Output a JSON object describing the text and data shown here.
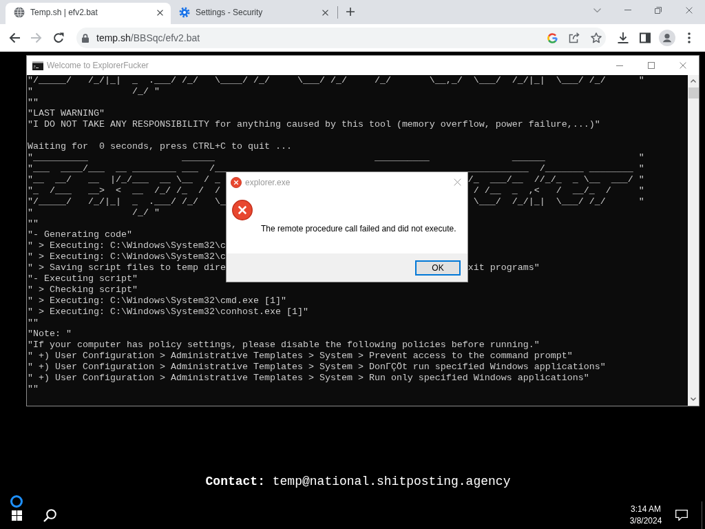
{
  "browser": {
    "tabs": [
      {
        "title": "Temp.sh | efv2.bat",
        "selected": true
      },
      {
        "title": "Settings - Security",
        "selected": false
      }
    ],
    "nav": [
      {
        "kind": "back",
        "disabled": false
      },
      {
        "kind": "forward",
        "disabled": true
      },
      {
        "kind": "reload",
        "disabled": false
      }
    ],
    "address": {
      "host": "temp.sh",
      "path": "/BBSqc/efv2.bat"
    }
  },
  "console_window": {
    "title": "Welcome to ExplorerFucker",
    "lines": [
      {
        "kind": "text",
        "text": "\"/_____/   /_/|_|  _  .___/ /_/   \\____/ /_/     \\___/ /_/     /_/       \\__,_/  \\___/  /_/|_|  \\___/ /_/      \""
      },
      {
        "kind": "text",
        "text": "\"                  /_/ \""
      },
      {
        "kind": "text",
        "text": "\"\""
      },
      {
        "kind": "text",
        "text": "\"LAST WARNING\""
      },
      {
        "kind": "text",
        "text": "\"I DO NOT TAKE ANY RESPONSIBILITY for anything caused by this tool (memory overflow, power failure,...)\""
      },
      {
        "kind": "blank"
      },
      {
        "kind": "text",
        "text": "Waiting for  0 seconds, press CTRL+C to quit ..."
      },
      {
        "kind": "text",
        "text": "\"__________                 ______                             __________               ______                 \""
      },
      {
        "kind": "split",
        "left": "\"___  ____/___  __ ________ ___  /__",
        "right": "___________  /_______ ________ \""
      },
      {
        "kind": "split",
        "left": "\"__  __/   __  |/_/___  __ \\__  / _",
        "right": "/_  ___/__  //_/_  _ \\__  ___/ \""
      },
      {
        "kind": "split",
        "left": "\"_  /___   __>  <  __  /_/ /_  /  /",
        "right": " / /__  _  ,<   /  __/_  /     \""
      },
      {
        "kind": "split",
        "left": "\"/_____/   /_/|_|  _  .___/ /_/   \\_",
        "right": " \\___/  /_/|_|  \\___/ /_/      \""
      },
      {
        "kind": "text",
        "text": "\"                  /_/ \""
      },
      {
        "kind": "text",
        "text": "\"\""
      },
      {
        "kind": "text",
        "text": "\"- Generating code\""
      },
      {
        "kind": "text",
        "text": "\" > Executing: C:\\Windows\\System32\\c"
      },
      {
        "kind": "text",
        "text": "\" > Executing: C:\\Windows\\System32\\c"
      },
      {
        "kind": "split",
        "left": "\" > Saving script files to temp dire",
        "right": "xit programs\""
      },
      {
        "kind": "text",
        "text": "\"- Executing script\""
      },
      {
        "kind": "text",
        "text": "\" > Checking script\""
      },
      {
        "kind": "text",
        "text": "\" > Executing: C:\\Windows\\System32\\cmd.exe [1]\""
      },
      {
        "kind": "text",
        "text": "\" > Executing: C:\\Windows\\System32\\conhost.exe [1]\""
      },
      {
        "kind": "text",
        "text": "\"\""
      },
      {
        "kind": "text",
        "text": "\"Note: \""
      },
      {
        "kind": "text",
        "text": "\"If your computer has policy settings, please disable the following policies before running.\""
      },
      {
        "kind": "text",
        "text": "\" +) User Configuration > Administrative Templates > System > Prevent access to the command prompt\""
      },
      {
        "kind": "text",
        "text": "\" +) User Configuration > Administrative Templates > System > DonΓÇÖt run specified Windows applications\""
      },
      {
        "kind": "text",
        "text": "\" +) User Configuration > Administrative Templates > System > Run only specified Windows applications\""
      },
      {
        "kind": "text",
        "text": "\"\""
      }
    ]
  },
  "dialog": {
    "title": "explorer.exe",
    "message": "The remote procedure call failed and did not execute.",
    "buttons": [
      {
        "label": "OK",
        "default": true
      }
    ]
  },
  "contact": "**Contact:** temp@national.shitposting.agency",
  "taskbar": {
    "time": "3:14 AM",
    "date": "3/8/2024"
  }
}
